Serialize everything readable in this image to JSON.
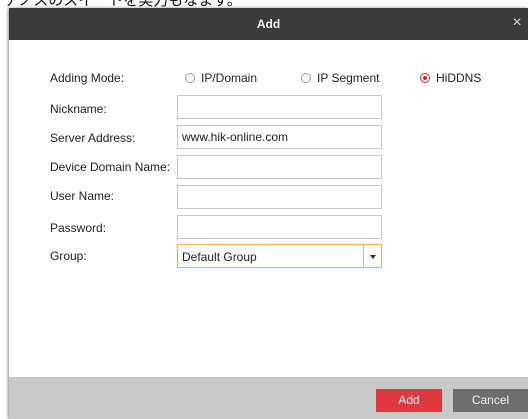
{
  "caption_text": "ナノスのスイートを実力もなます。",
  "dialog": {
    "title": "Add",
    "close_glyph": "×"
  },
  "form": {
    "adding_mode_label": "Adding Mode:",
    "modes": [
      {
        "label": "IP/Domain",
        "checked": false
      },
      {
        "label": "IP Segment",
        "checked": false
      },
      {
        "label": "HiDDNS",
        "checked": true
      }
    ],
    "nickname_label": "Nickname:",
    "nickname_value": "",
    "server_address_label": "Server Address:",
    "server_address_value": "www.hik-online.com",
    "device_domain_label": "Device Domain Name:",
    "device_domain_value": "",
    "user_name_label": "User Name:",
    "user_name_value": "",
    "password_label": "Password:",
    "password_value": "",
    "group_label": "Group:",
    "group_selected": "Default Group"
  },
  "footer": {
    "add_label": "Add",
    "cancel_label": "Cancel"
  },
  "colors": {
    "titlebar": "#3a3a3a",
    "accent_red": "#e0383e",
    "cancel_gray": "#6e6e6e",
    "footer_bg": "#c9c9c9",
    "select_border": "#e8b25c"
  }
}
